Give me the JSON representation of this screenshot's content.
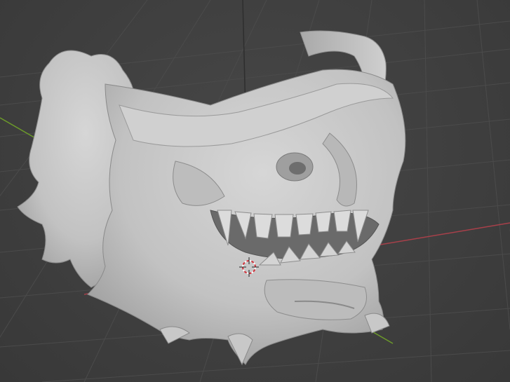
{
  "viewport": {
    "mode": "3D viewport",
    "shading": "solid",
    "background_color": "#404040",
    "grid_color": "#4a4a4a",
    "x_axis_color": "#a8404a",
    "y_axis_color": "#6c9a2a",
    "z_axis_color": "#2b2b2b",
    "object_color": "#c9c9c9"
  },
  "object": {
    "type": "sculpted mesh",
    "description_icon": "oni-mask-model"
  },
  "cursor": {
    "icon": "3d-cursor-icon"
  }
}
